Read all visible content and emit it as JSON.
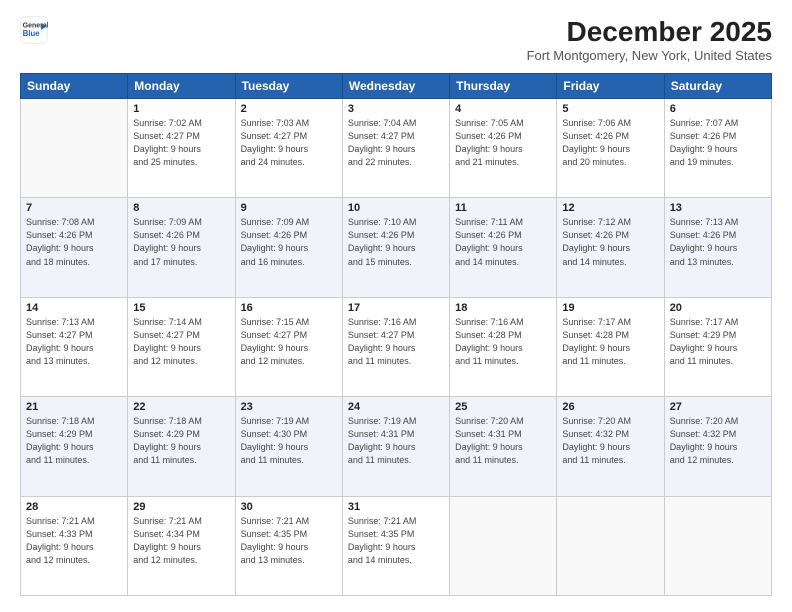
{
  "header": {
    "logo_line1": "General",
    "logo_line2": "Blue",
    "month_title": "December 2025",
    "location": "Fort Montgomery, New York, United States"
  },
  "weekdays": [
    "Sunday",
    "Monday",
    "Tuesday",
    "Wednesday",
    "Thursday",
    "Friday",
    "Saturday"
  ],
  "weeks": [
    [
      {
        "day": "",
        "info": ""
      },
      {
        "day": "1",
        "info": "Sunrise: 7:02 AM\nSunset: 4:27 PM\nDaylight: 9 hours\nand 25 minutes."
      },
      {
        "day": "2",
        "info": "Sunrise: 7:03 AM\nSunset: 4:27 PM\nDaylight: 9 hours\nand 24 minutes."
      },
      {
        "day": "3",
        "info": "Sunrise: 7:04 AM\nSunset: 4:27 PM\nDaylight: 9 hours\nand 22 minutes."
      },
      {
        "day": "4",
        "info": "Sunrise: 7:05 AM\nSunset: 4:26 PM\nDaylight: 9 hours\nand 21 minutes."
      },
      {
        "day": "5",
        "info": "Sunrise: 7:06 AM\nSunset: 4:26 PM\nDaylight: 9 hours\nand 20 minutes."
      },
      {
        "day": "6",
        "info": "Sunrise: 7:07 AM\nSunset: 4:26 PM\nDaylight: 9 hours\nand 19 minutes."
      }
    ],
    [
      {
        "day": "7",
        "info": "Sunrise: 7:08 AM\nSunset: 4:26 PM\nDaylight: 9 hours\nand 18 minutes."
      },
      {
        "day": "8",
        "info": "Sunrise: 7:09 AM\nSunset: 4:26 PM\nDaylight: 9 hours\nand 17 minutes."
      },
      {
        "day": "9",
        "info": "Sunrise: 7:09 AM\nSunset: 4:26 PM\nDaylight: 9 hours\nand 16 minutes."
      },
      {
        "day": "10",
        "info": "Sunrise: 7:10 AM\nSunset: 4:26 PM\nDaylight: 9 hours\nand 15 minutes."
      },
      {
        "day": "11",
        "info": "Sunrise: 7:11 AM\nSunset: 4:26 PM\nDaylight: 9 hours\nand 14 minutes."
      },
      {
        "day": "12",
        "info": "Sunrise: 7:12 AM\nSunset: 4:26 PM\nDaylight: 9 hours\nand 14 minutes."
      },
      {
        "day": "13",
        "info": "Sunrise: 7:13 AM\nSunset: 4:26 PM\nDaylight: 9 hours\nand 13 minutes."
      }
    ],
    [
      {
        "day": "14",
        "info": "Sunrise: 7:13 AM\nSunset: 4:27 PM\nDaylight: 9 hours\nand 13 minutes."
      },
      {
        "day": "15",
        "info": "Sunrise: 7:14 AM\nSunset: 4:27 PM\nDaylight: 9 hours\nand 12 minutes."
      },
      {
        "day": "16",
        "info": "Sunrise: 7:15 AM\nSunset: 4:27 PM\nDaylight: 9 hours\nand 12 minutes."
      },
      {
        "day": "17",
        "info": "Sunrise: 7:16 AM\nSunset: 4:27 PM\nDaylight: 9 hours\nand 11 minutes."
      },
      {
        "day": "18",
        "info": "Sunrise: 7:16 AM\nSunset: 4:28 PM\nDaylight: 9 hours\nand 11 minutes."
      },
      {
        "day": "19",
        "info": "Sunrise: 7:17 AM\nSunset: 4:28 PM\nDaylight: 9 hours\nand 11 minutes."
      },
      {
        "day": "20",
        "info": "Sunrise: 7:17 AM\nSunset: 4:29 PM\nDaylight: 9 hours\nand 11 minutes."
      }
    ],
    [
      {
        "day": "21",
        "info": "Sunrise: 7:18 AM\nSunset: 4:29 PM\nDaylight: 9 hours\nand 11 minutes."
      },
      {
        "day": "22",
        "info": "Sunrise: 7:18 AM\nSunset: 4:29 PM\nDaylight: 9 hours\nand 11 minutes."
      },
      {
        "day": "23",
        "info": "Sunrise: 7:19 AM\nSunset: 4:30 PM\nDaylight: 9 hours\nand 11 minutes."
      },
      {
        "day": "24",
        "info": "Sunrise: 7:19 AM\nSunset: 4:31 PM\nDaylight: 9 hours\nand 11 minutes."
      },
      {
        "day": "25",
        "info": "Sunrise: 7:20 AM\nSunset: 4:31 PM\nDaylight: 9 hours\nand 11 minutes."
      },
      {
        "day": "26",
        "info": "Sunrise: 7:20 AM\nSunset: 4:32 PM\nDaylight: 9 hours\nand 11 minutes."
      },
      {
        "day": "27",
        "info": "Sunrise: 7:20 AM\nSunset: 4:32 PM\nDaylight: 9 hours\nand 12 minutes."
      }
    ],
    [
      {
        "day": "28",
        "info": "Sunrise: 7:21 AM\nSunset: 4:33 PM\nDaylight: 9 hours\nand 12 minutes."
      },
      {
        "day": "29",
        "info": "Sunrise: 7:21 AM\nSunset: 4:34 PM\nDaylight: 9 hours\nand 12 minutes."
      },
      {
        "day": "30",
        "info": "Sunrise: 7:21 AM\nSunset: 4:35 PM\nDaylight: 9 hours\nand 13 minutes."
      },
      {
        "day": "31",
        "info": "Sunrise: 7:21 AM\nSunset: 4:35 PM\nDaylight: 9 hours\nand 14 minutes."
      },
      {
        "day": "",
        "info": ""
      },
      {
        "day": "",
        "info": ""
      },
      {
        "day": "",
        "info": ""
      }
    ]
  ]
}
